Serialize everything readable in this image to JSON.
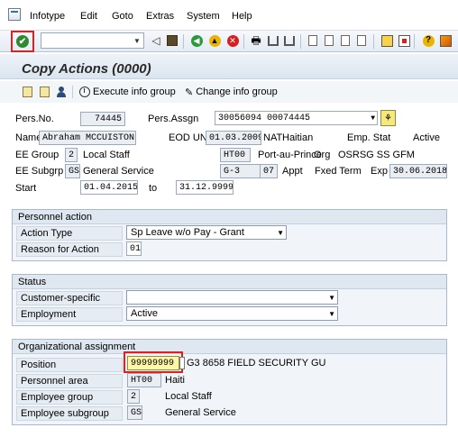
{
  "menubar": {
    "items": [
      "Infotype",
      "Edit",
      "Goto",
      "Extras",
      "System",
      "Help"
    ]
  },
  "toolbar": {
    "command_field": ""
  },
  "title": "Copy Actions (0000)",
  "app_toolbar": {
    "execute_label": "Execute info group",
    "change_label": "Change info group"
  },
  "header": {
    "pers_no_label": "Pers.No.",
    "pers_no": "74445",
    "pers_assgn_label": "Pers.Assgn",
    "pers_assgn": "30056094 00074445",
    "name_label": "Name",
    "name": "Abraham MCCUISTON",
    "eod_label": "EOD UN",
    "eod": "01.03.2009",
    "nat_label": "NAT",
    "nat": "Haitian",
    "emp_stat_label": "Emp. Stat",
    "emp_stat": "Active",
    "ee_group_label": "EE Group",
    "ee_group_code": "2",
    "ee_group_text": "Local Staff",
    "location_code": "HT00",
    "location_text": "Port-au-Prince",
    "org_label": "Org",
    "org": "OSRSG SS GFM",
    "ee_subgrp_label": "EE Subgrp",
    "ee_subgrp_code": "GS",
    "ee_subgrp_text": "General Service",
    "grade": "G-3",
    "step": "07",
    "appt_label": "Appt",
    "appt": "Fxed Term",
    "exp_label": "Exp",
    "exp": "30.06.2018",
    "start_label": "Start",
    "start": "01.04.2015",
    "to_label": "to",
    "end": "31.12.9999"
  },
  "personnel_action": {
    "header": "Personnel action",
    "action_type_label": "Action Type",
    "action_type": "Sp Leave w/o Pay - Grant",
    "reason_label": "Reason for Action",
    "reason": "01"
  },
  "status": {
    "header": "Status",
    "customer_label": "Customer-specific",
    "customer": "",
    "employment_label": "Employment",
    "employment": "Active"
  },
  "org_assignment": {
    "header": "Organizational assignment",
    "position_label": "Position",
    "position": "99999999",
    "position_text": "G3 8658 FIELD SECURITY GU",
    "area_label": "Personnel area",
    "area_code": "HT00",
    "area_text": "Haiti",
    "group_label": "Employee group",
    "group_code": "2",
    "group_text": "Local Staff",
    "subgroup_label": "Employee subgroup",
    "subgroup_code": "GS",
    "subgroup_text": "General Service"
  }
}
